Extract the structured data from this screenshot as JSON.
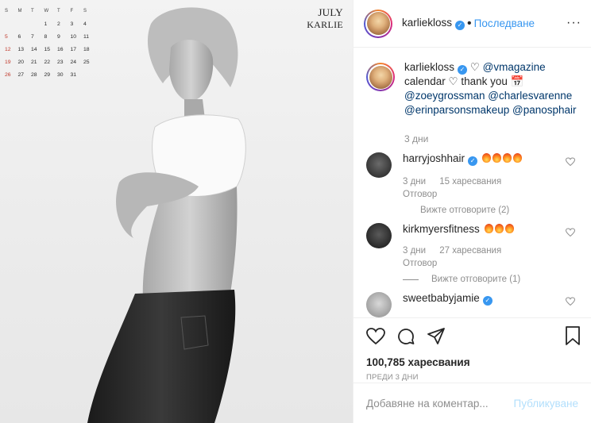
{
  "photo": {
    "calendar": {
      "weekdays": [
        "S",
        "M",
        "T",
        "W",
        "T",
        "F",
        "S"
      ],
      "weeks": [
        [
          "",
          "",
          "",
          "1",
          "2",
          "3",
          "4"
        ],
        [
          "5",
          "6",
          "7",
          "8",
          "9",
          "10",
          "11"
        ],
        [
          "12",
          "13",
          "14",
          "15",
          "16",
          "17",
          "18"
        ],
        [
          "19",
          "20",
          "21",
          "22",
          "23",
          "24",
          "25"
        ],
        [
          "26",
          "27",
          "28",
          "29",
          "30",
          "31",
          ""
        ]
      ]
    },
    "month_title": "JULY",
    "month_name": "KARLIE"
  },
  "header": {
    "username": "karliekloss",
    "verified_icon": "verified-badge-icon",
    "follow_label": "Последване",
    "separator": "•",
    "more_label": "···"
  },
  "caption": {
    "username": "karliekloss",
    "text_parts": [
      "♡ ",
      "@vmagazine",
      " calendar ♡ thank you 📅 ",
      "@zoeygrossman",
      " ",
      "@charlesvarenne",
      " ",
      "@erinparsonsmakeup",
      " ",
      "@panosphair"
    ],
    "time": "3 дни"
  },
  "comments": [
    {
      "username": "harryjoshhair",
      "emoji_count": 4,
      "time": "3 дни",
      "likes": "15 харесвания",
      "reply": "Отговор",
      "view_replies": "Вижте отговорите (2)"
    },
    {
      "username": "kirkmyersfitness",
      "emoji_count": 3,
      "time": "3 дни",
      "likes": "27 харесвания",
      "reply": "Отговор",
      "view_replies": "Вижте отговорите (1)"
    },
    {
      "username": "sweetbabyjamie",
      "emoji_count": 0,
      "time": "",
      "likes": "",
      "reply": "",
      "view_replies": ""
    }
  ],
  "actions": {
    "likes": "100,785 харесвания",
    "ago": "ПРЕДИ 3 ДНИ"
  },
  "add_comment": {
    "placeholder": "Добавяне на коментар...",
    "publish": "Публикуване"
  },
  "colors": {
    "accent": "#3897f0",
    "mention": "#00376b",
    "muted": "#8e8e8e",
    "publish_disabled": "#b2dffc"
  }
}
